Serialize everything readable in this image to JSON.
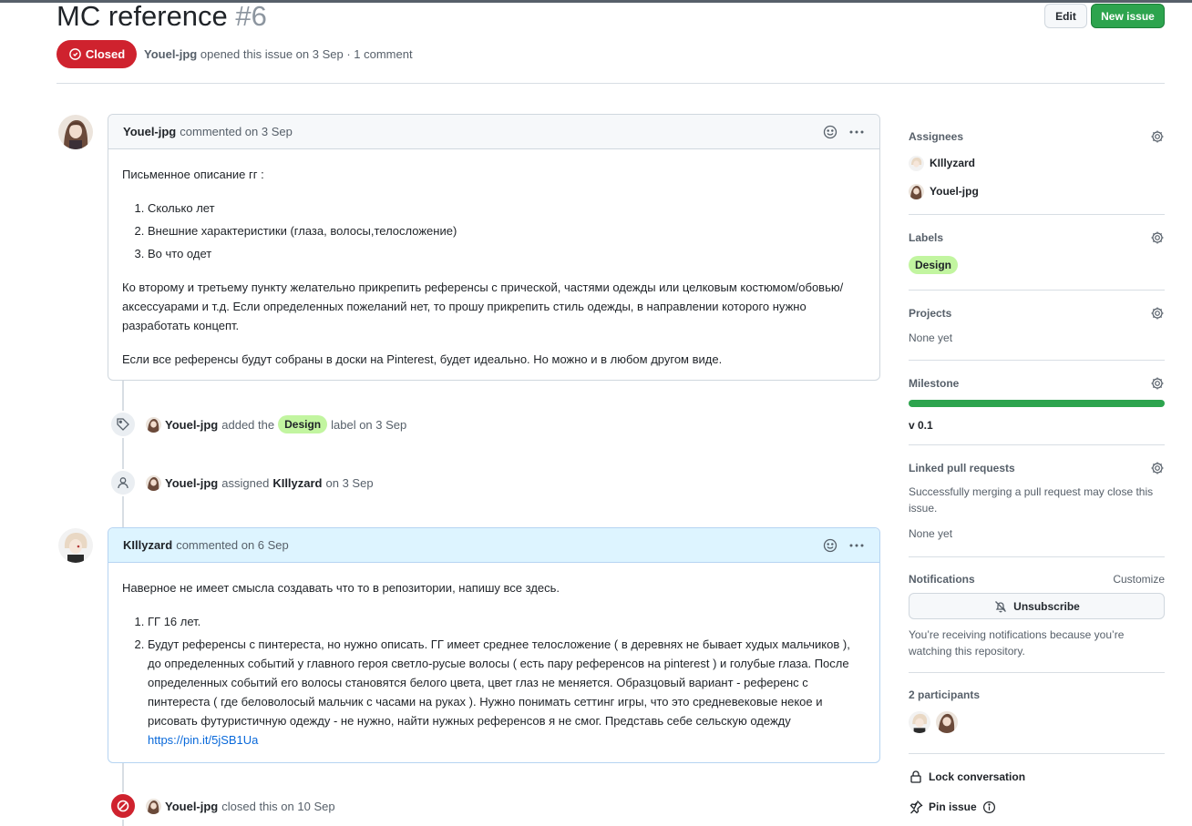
{
  "issue": {
    "title": "MC reference",
    "number": "#6",
    "state": "Closed",
    "author": "Youel-jpg",
    "meta_rest": "opened this issue on 3 Sep · 1 comment",
    "edit_label": "Edit",
    "new_issue_label": "New issue"
  },
  "comments": [
    {
      "author": "Youel-jpg",
      "when": "commented on 3 Sep",
      "intro": "Письменное описание гг :",
      "list": [
        "Сколько лет",
        "Внешние характеристики (глаза, волосы,телосложение)",
        "Во что одет"
      ],
      "para1": "Ко второму и третьему пункту желательно прикрепить референсы с прической, частями одежды или целковым костюмом/обовью/аксессуарами и т.д. Если определенных пожеланий нет, то прошу прикрепить стиль одежды, в направлении которого нужно разработать концепт.",
      "para2": "Если все референсы будут собраны в доски на Pinterest, будет идеально. Но можно и в любом другом виде."
    },
    {
      "author": "KIllyzard",
      "when": "commented on 6 Sep",
      "intro": "Наверное не имеет смысла создавать что то в репозитории, напишу все здесь.",
      "item1": "ГГ 16 лет.",
      "item2": "Будут референсы с пинтереста, но нужно описать. ГГ имеет среднее телосложение ( в деревнях не бывает худых мальчиков ), до определенных событий у главного героя светло-русые волосы ( есть пару референсов на pinterest ) и голубые глаза. После определенных событий его волосы становятся белого цвета, цвет глаз не меняется. Образцовый вариант - референс с пинтереста ( где беловолосый мальчик с часами на руках ). Нужно понимать сеттинг игры, что это средневековые некое и рисовать футуристичную одежду - не нужно, найти нужных референсов я не смог. Представь себе сельскую одежду",
      "link": "https://pin.it/5jSB1Ua"
    }
  ],
  "events": {
    "label_actor": "Youel-jpg",
    "label_pre": "added the",
    "label_name": "Design",
    "label_post": "label on 3 Sep",
    "assign_actor": "Youel-jpg",
    "assign_verb": "assigned",
    "assign_target": "KIllyzard",
    "assign_post": "on 3 Sep",
    "close_actor": "Youel-jpg",
    "close_text": "closed this on 10 Sep"
  },
  "sidebar": {
    "assignees_title": "Assignees",
    "assignees": [
      "KIllyzard",
      "Youel-jpg"
    ],
    "labels_title": "Labels",
    "label": "Design",
    "projects_title": "Projects",
    "projects_value": "None yet",
    "milestone_title": "Milestone",
    "milestone_progress": 1.0,
    "milestone_name": "v 0.1",
    "linked_title": "Linked pull requests",
    "linked_desc": "Successfully merging a pull request may close this issue.",
    "linked_value": "None yet",
    "notifications_title": "Notifications",
    "customize": "Customize",
    "unsubscribe": "Unsubscribe",
    "notif_desc": "You’re receiving notifications because you’re watching this repository.",
    "participants_title": "2 participants",
    "lock": "Lock conversation",
    "pin": "Pin issue"
  },
  "colors": {
    "closed": "#cf222e",
    "primary": "#2da44e",
    "label_design": "#c2f5a0",
    "link": "#0969da"
  }
}
